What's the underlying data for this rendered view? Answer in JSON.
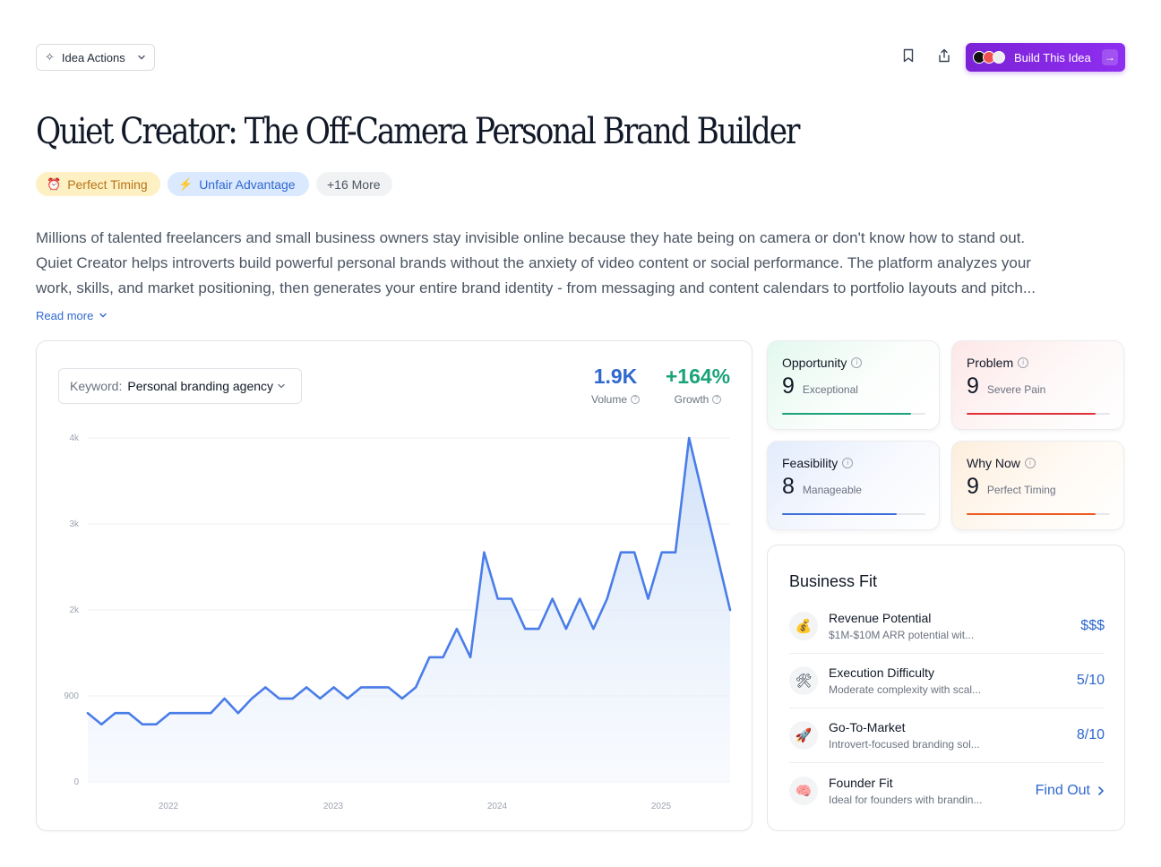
{
  "header": {
    "idea_actions_label": "Idea Actions",
    "build_label": "Build This Idea",
    "colors": {
      "build_button": "#7b22d6"
    }
  },
  "title": "Quiet Creator: The Off-Camera Personal Brand Builder",
  "tags": [
    {
      "icon": "alarm-clock-icon",
      "label": "Perfect Timing"
    },
    {
      "icon": "lightning-icon",
      "label": "Unfair Advantage"
    },
    {
      "label": "+16 More"
    }
  ],
  "description": {
    "lines": [
      "Millions of talented freelancers and small business owners stay invisible online because they hate being on camera or don't know how to stand out.",
      "Quiet Creator helps introverts build powerful personal brands without the anxiety of video content or social performance. The platform analyzes your",
      "work, skills, and market positioning, then generates your entire brand identity - from messaging and content calendars to portfolio layouts and pitch..."
    ],
    "read_more": "Read more"
  },
  "keyword": {
    "label": "Keyword:",
    "value": "Personal branding agency"
  },
  "metrics": {
    "volume": {
      "value": "1.9K",
      "label": "Volume"
    },
    "growth": {
      "value": "+164%",
      "label": "Growth"
    }
  },
  "chart_data": {
    "type": "area",
    "title": "",
    "xlabel": "",
    "ylabel": "",
    "ylim": [
      0,
      4000
    ],
    "yticks": [
      0,
      1000,
      2000,
      3000,
      4000
    ],
    "ytick_labels": [
      "0",
      "900",
      "2k",
      "3k",
      "4k"
    ],
    "xtick_labels": [
      "2022",
      "2023",
      "2024",
      "2025"
    ],
    "grid": true,
    "series": [
      {
        "values": [
          800,
          670,
          800,
          800,
          670,
          670,
          800,
          800,
          800,
          800,
          970,
          800,
          970,
          1100,
          970,
          970,
          1100,
          970,
          1100,
          970,
          1100,
          1100,
          1100,
          970,
          1100,
          1450,
          1450,
          1780,
          1450,
          2670,
          2130,
          2130,
          1780,
          1780,
          2130,
          1780,
          2130,
          1780,
          2130,
          2670,
          2670,
          2130,
          2670,
          2670,
          4000,
          3330,
          2670,
          2000
        ],
        "color": "#4a7de8"
      }
    ]
  },
  "scores": [
    {
      "name": "Opportunity",
      "value": "9",
      "label": "Exceptional",
      "fraction": 0.9,
      "color": "#1aa37a"
    },
    {
      "name": "Problem",
      "value": "9",
      "label": "Severe Pain",
      "fraction": 0.9,
      "color": "#e0313b"
    },
    {
      "name": "Feasibility",
      "value": "8",
      "label": "Manageable",
      "fraction": 0.8,
      "color": "#3f6fd8"
    },
    {
      "name": "Why Now",
      "value": "9",
      "label": "Perfect Timing",
      "fraction": 0.9,
      "color": "#ec5a1e"
    }
  ],
  "business_fit": {
    "title": "Business Fit",
    "items": [
      {
        "icon": "money-bag-icon",
        "title": "Revenue Potential",
        "sub": "$1M-$10M ARR potential wit...",
        "value": "$$$"
      },
      {
        "icon": "hammer-wrench-icon",
        "title": "Execution Difficulty",
        "sub": "Moderate complexity with scal...",
        "value": "5/10"
      },
      {
        "icon": "rocket-icon",
        "title": "Go-To-Market",
        "sub": "Introvert-focused branding sol...",
        "value": "8/10"
      },
      {
        "icon": "brain-icon",
        "title": "Founder Fit",
        "sub": "Ideal for founders with brandin...",
        "value": "Find Out"
      }
    ]
  }
}
